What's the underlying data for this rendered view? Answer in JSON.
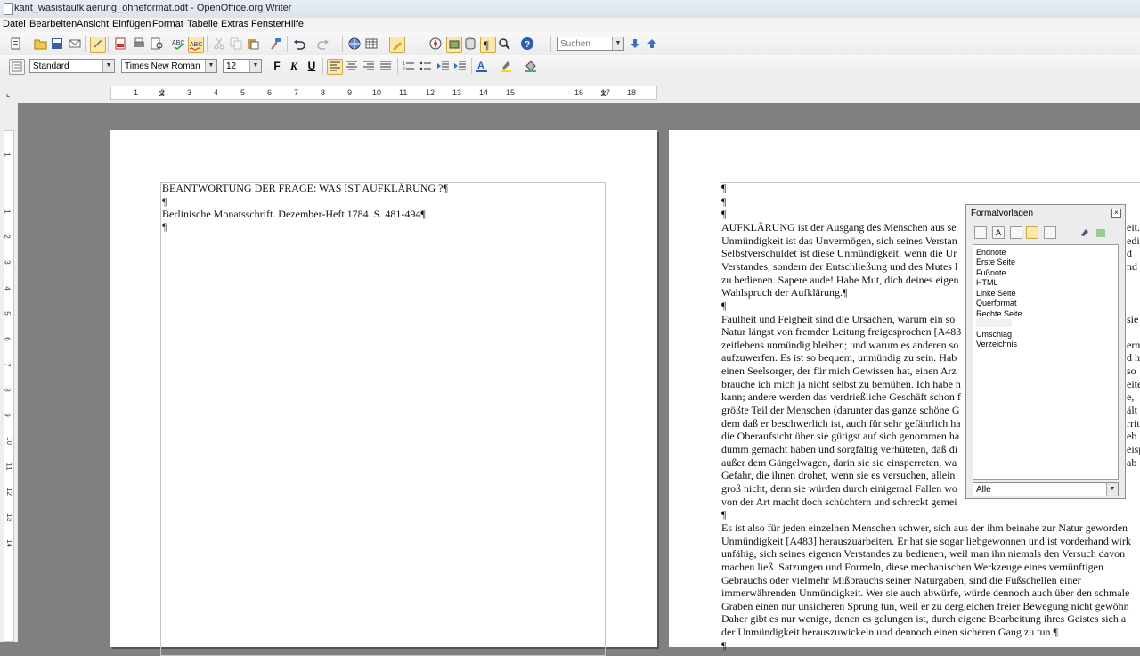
{
  "window": {
    "title": "kant_wasistaufklaerung_ohneformat.odt - OpenOffice.org Writer"
  },
  "menubar": {
    "items": [
      "Datei",
      "Bearbeiten",
      "Ansicht",
      "Einfügen",
      "Format",
      "Tabelle",
      "Extras",
      "Fenster",
      "Hilfe"
    ]
  },
  "toolbar": {
    "search_placeholder": "Suchen",
    "icons": [
      "new-document-icon",
      "open-icon",
      "save-icon",
      "email-icon",
      "edit-mode-icon",
      "export-pdf-icon",
      "print-icon",
      "page-preview-icon",
      "spellcheck-icon",
      "autospell-icon",
      "cut-icon",
      "copy-icon",
      "paste-icon",
      "format-paintbrush-icon",
      "undo-icon",
      "redo-icon",
      "hyperlink-icon",
      "table-icon",
      "show-draw-functions-icon",
      "navigator-icon",
      "gallery-icon",
      "data-sources-icon",
      "nonprinting-chars-icon",
      "zoom-icon",
      "help-icon",
      "find-next-icon",
      "find-prev-icon"
    ]
  },
  "formatting": {
    "paragraph_style": "Standard",
    "font_name": "Times New Roman",
    "font_size": "12",
    "bold": "F",
    "italic": "K",
    "underline": "U"
  },
  "ruler": {
    "numbers": [
      "1",
      "2",
      "3",
      "4",
      "5",
      "6",
      "7",
      "8",
      "9",
      "10",
      "11",
      "12",
      "13",
      "14",
      "15",
      "16",
      "17",
      "18"
    ],
    "vertical_numbers": [
      "1",
      "1",
      "2",
      "3",
      "4",
      "5",
      "6",
      "7",
      "8",
      "9",
      "10",
      "11",
      "12",
      "13",
      "14"
    ]
  },
  "page_left": {
    "lines": [
      "BEANTWORTUNG DER FRAGE: WAS IST AUFKLÄRUNG ?¶",
      "¶",
      "Berlinische Monatsschrift. Dezember-Heft 1784. S. 481-494¶",
      "¶"
    ]
  },
  "page_right": {
    "lines": [
      "¶",
      "¶",
      "¶",
      "AUFKLÄRUNG ist der Ausgang des Menschen aus se",
      "Unmündigkeit ist das Unvermögen, sich seines Verstan",
      "Selbstverschuldet ist diese Unmündigkeit, wenn die Ur",
      "Verstandes, sondern der Entschließung und des Mutes l",
      "zu bedienen. Sapere aude! Habe Mut, dich deines eigen",
      "Wahlspruch der Aufklärung.¶",
      "¶",
      "Faulheit und Feigheit sind die Ursachen, warum ein so",
      "Natur längst von fremder Leitung freigesprochen [A483",
      "zeitlebens unmündig bleiben; und warum es anderen so",
      "aufzuwerfen. Es ist so bequem, unmündig zu sein. Hab",
      "einen Seelsorger, der für mich Gewissen hat, einen Arz",
      "brauche ich mich ja nicht selbst zu bemühen. Ich habe n",
      "kann; andere werden das verdrießliche Geschäft schon f",
      "größte Teil der Menschen (darunter das ganze schöne G",
      "dem daß er beschwerlich ist, auch für sehr gefährlich ha",
      "die Oberaufsicht über sie gütigst auf sich genommen ha",
      "dumm gemacht haben und sorgfältig verhüteten, daß di",
      "außer dem Gängelwagen, darin sie sie einsperreten, wa",
      "Gefahr, die ihnen drohet, wenn sie es versuchen, allein",
      "groß nicht, denn sie würden durch einigemal Fallen wo",
      "von der Art macht doch schüchtern und schreckt gemei",
      "¶",
      "Es ist also für jeden einzelnen Menschen schwer, sich aus der ihm beinahe zur Natur geworden",
      "Unmündigkeit [A483] herauszuarbeiten. Er hat sie sogar liebgewonnen und ist vorderhand wirk",
      "unfähig, sich seines eigenen Verstandes zu bedienen, weil man ihn niemals den Versuch davon",
      "machen ließ. Satzungen und Formeln, diese mechanischen Werkzeuge eines vernünftigen",
      "Gebrauchs oder vielmehr Mißbrauchs seiner Naturgaben, sind die Fußschellen einer",
      "immerwährenden Unmündigkeit. Wer sie auch abwürfe, würde dennoch auch über den schmale",
      "Graben einen nur unsicheren Sprung tun, weil er zu dergleichen freier Bewegung nicht gewöhn",
      "Daher gibt es nur wenige, denen es gelungen ist, durch eigene Bearbeitung ihres Geistes sich a",
      "der Unmündigkeit herauszuwickeln und dennoch einen sicheren Gang zu tun.¶",
      "¶"
    ],
    "right_edge_fragments": [
      "eit.",
      "edi",
      "d",
      "nd",
      "",
      "",
      "",
      "sie",
      "",
      "ern",
      "d ha",
      "so",
      "eite",
      "e,",
      "ält",
      "rritt",
      "eb",
      "eisp",
      "ab"
    ]
  },
  "format_panel": {
    "title": "Formatvorlagen",
    "close": "x",
    "styles": [
      "Endnote",
      "Erste Seite",
      "Fußnote",
      "HTML",
      "Linke Seite",
      "Querformat",
      "Rechte Seite",
      "",
      "Umschlag",
      "Verzeichnis"
    ],
    "filter": "Alle"
  }
}
